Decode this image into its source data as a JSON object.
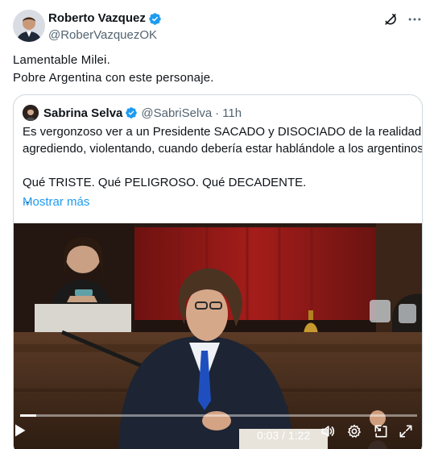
{
  "author": {
    "name": "Roberto Vazquez",
    "handle": "@RoberVazquezOK"
  },
  "tweet": {
    "lines": [
      "Lamentable Milei.",
      "Pobre Argentina con este personaje."
    ]
  },
  "quote": {
    "name": "Sabrina Selva",
    "handle": "@SabriSelva",
    "separator": "·",
    "time": "11h",
    "lines": [
      "Es vergonzoso ver a un Presidente SACADO y DISOCIADO de la realidad,",
      "agrediendo, violentando, cuando debería estar hablándole a los argentinos.",
      "",
      "Qué TRISTE. Qué PELIGROSO. Qué DECADENTE.",
      "..."
    ],
    "show_more": "Mostrar más"
  },
  "video": {
    "progress": 0.04,
    "time": "0:03 / 1:22"
  },
  "icons": {
    "grok": "grok-icon",
    "more": "more-options-icon",
    "verified": "verified-badge-icon",
    "play": "play-icon",
    "volume": "volume-icon",
    "settings": "settings-icon",
    "pip": "picture-in-picture-icon",
    "fullscreen": "fullscreen-icon"
  },
  "colors": {
    "link": "#1d9bf0",
    "verified": "#1d9bf0",
    "muted": "#536471",
    "border": "#cfd9de"
  }
}
